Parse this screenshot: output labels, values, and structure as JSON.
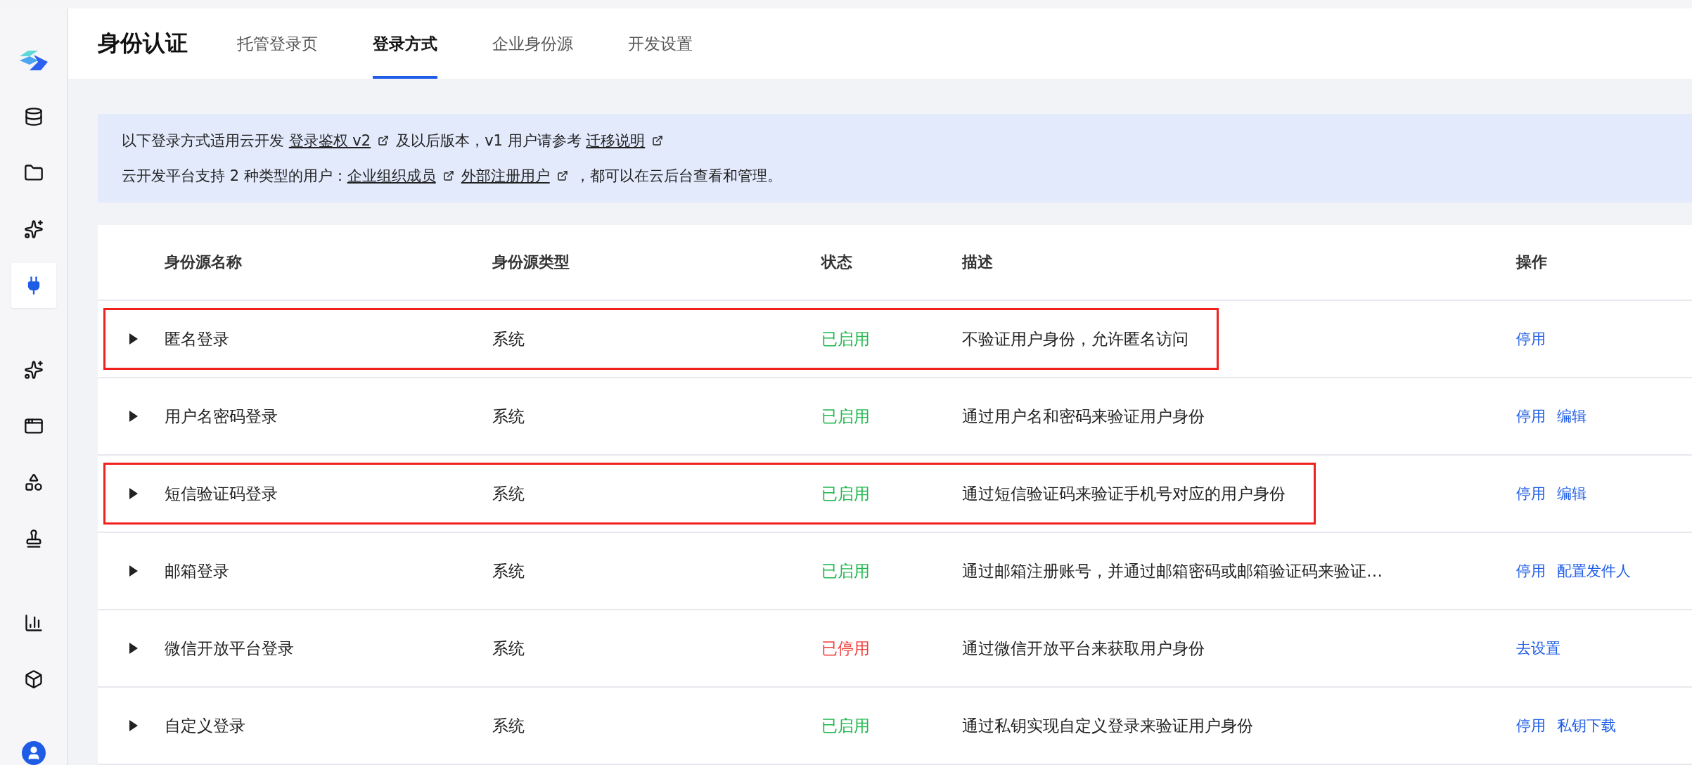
{
  "sidebar": {
    "groups": [
      [
        {
          "selected": false
        },
        {
          "selected": false
        },
        {
          "selected": false
        },
        {
          "selected": false
        },
        {
          "selected": true
        }
      ],
      [
        {
          "selected": false
        },
        {
          "selected": false
        },
        {
          "selected": false
        },
        {
          "selected": false
        }
      ],
      [
        {
          "selected": false
        },
        {
          "selected": false
        }
      ],
      [
        {
          "selected": false
        }
      ]
    ]
  },
  "header": {
    "title": "身份认证",
    "tabs": [
      {
        "label": "托管登录页",
        "selected": false
      },
      {
        "label": "登录方式",
        "selected": true
      },
      {
        "label": "企业身份源",
        "selected": false
      },
      {
        "label": "开发设置",
        "selected": false
      }
    ]
  },
  "notice": {
    "lines": [
      [
        {
          "kind": "text",
          "text": "以下登录方式适用云开发 "
        },
        {
          "kind": "link",
          "text": "登录鉴权 v2"
        },
        {
          "kind": "text",
          "text": "及以后版本，v1 用户请参考 "
        },
        {
          "kind": "link",
          "text": "迁移说明"
        }
      ],
      [
        {
          "kind": "text",
          "text": "云开发平台支持 2 种类型的用户："
        },
        {
          "kind": "link",
          "text": "企业组织成员"
        },
        {
          "kind": "link",
          "text": "外部注册用户"
        },
        {
          "kind": "text",
          "text": "，都可以在云后台查看和管理。"
        }
      ]
    ]
  },
  "table": {
    "columns": [
      "身份源名称",
      "身份源类型",
      "状态",
      "描述",
      "操作"
    ],
    "rows": [
      {
        "name": "匿名登录",
        "type": "系统",
        "status": "已启用",
        "enabled": true,
        "description": "不验证用户身份，允许匿名访问",
        "actions": [
          "停用"
        ],
        "highlighted": true
      },
      {
        "name": "用户名密码登录",
        "type": "系统",
        "status": "已启用",
        "enabled": true,
        "description": "通过用户名和密码来验证用户身份",
        "actions": [
          "停用",
          "编辑"
        ],
        "highlighted": false
      },
      {
        "name": "短信验证码登录",
        "type": "系统",
        "status": "已启用",
        "enabled": true,
        "description": "通过短信验证码来验证手机号对应的用户身份",
        "actions": [
          "停用",
          "编辑"
        ],
        "highlighted": true
      },
      {
        "name": "邮箱登录",
        "type": "系统",
        "status": "已启用",
        "enabled": true,
        "description": "通过邮箱注册账号，并通过邮箱密码或邮箱验证码来验证…",
        "actions": [
          "停用",
          "配置发件人"
        ],
        "highlighted": false
      },
      {
        "name": "微信开放平台登录",
        "type": "系统",
        "status": "已停用",
        "enabled": false,
        "description": "通过微信开放平台来获取用户身份",
        "actions": [
          "去设置"
        ],
        "highlighted": false
      },
      {
        "name": "自定义登录",
        "type": "系统",
        "status": "已启用",
        "enabled": true,
        "description": "通过私钥实现自定义登录来验证用户身份",
        "actions": [
          "停用",
          "私钥下载"
        ],
        "highlighted": false
      }
    ]
  }
}
